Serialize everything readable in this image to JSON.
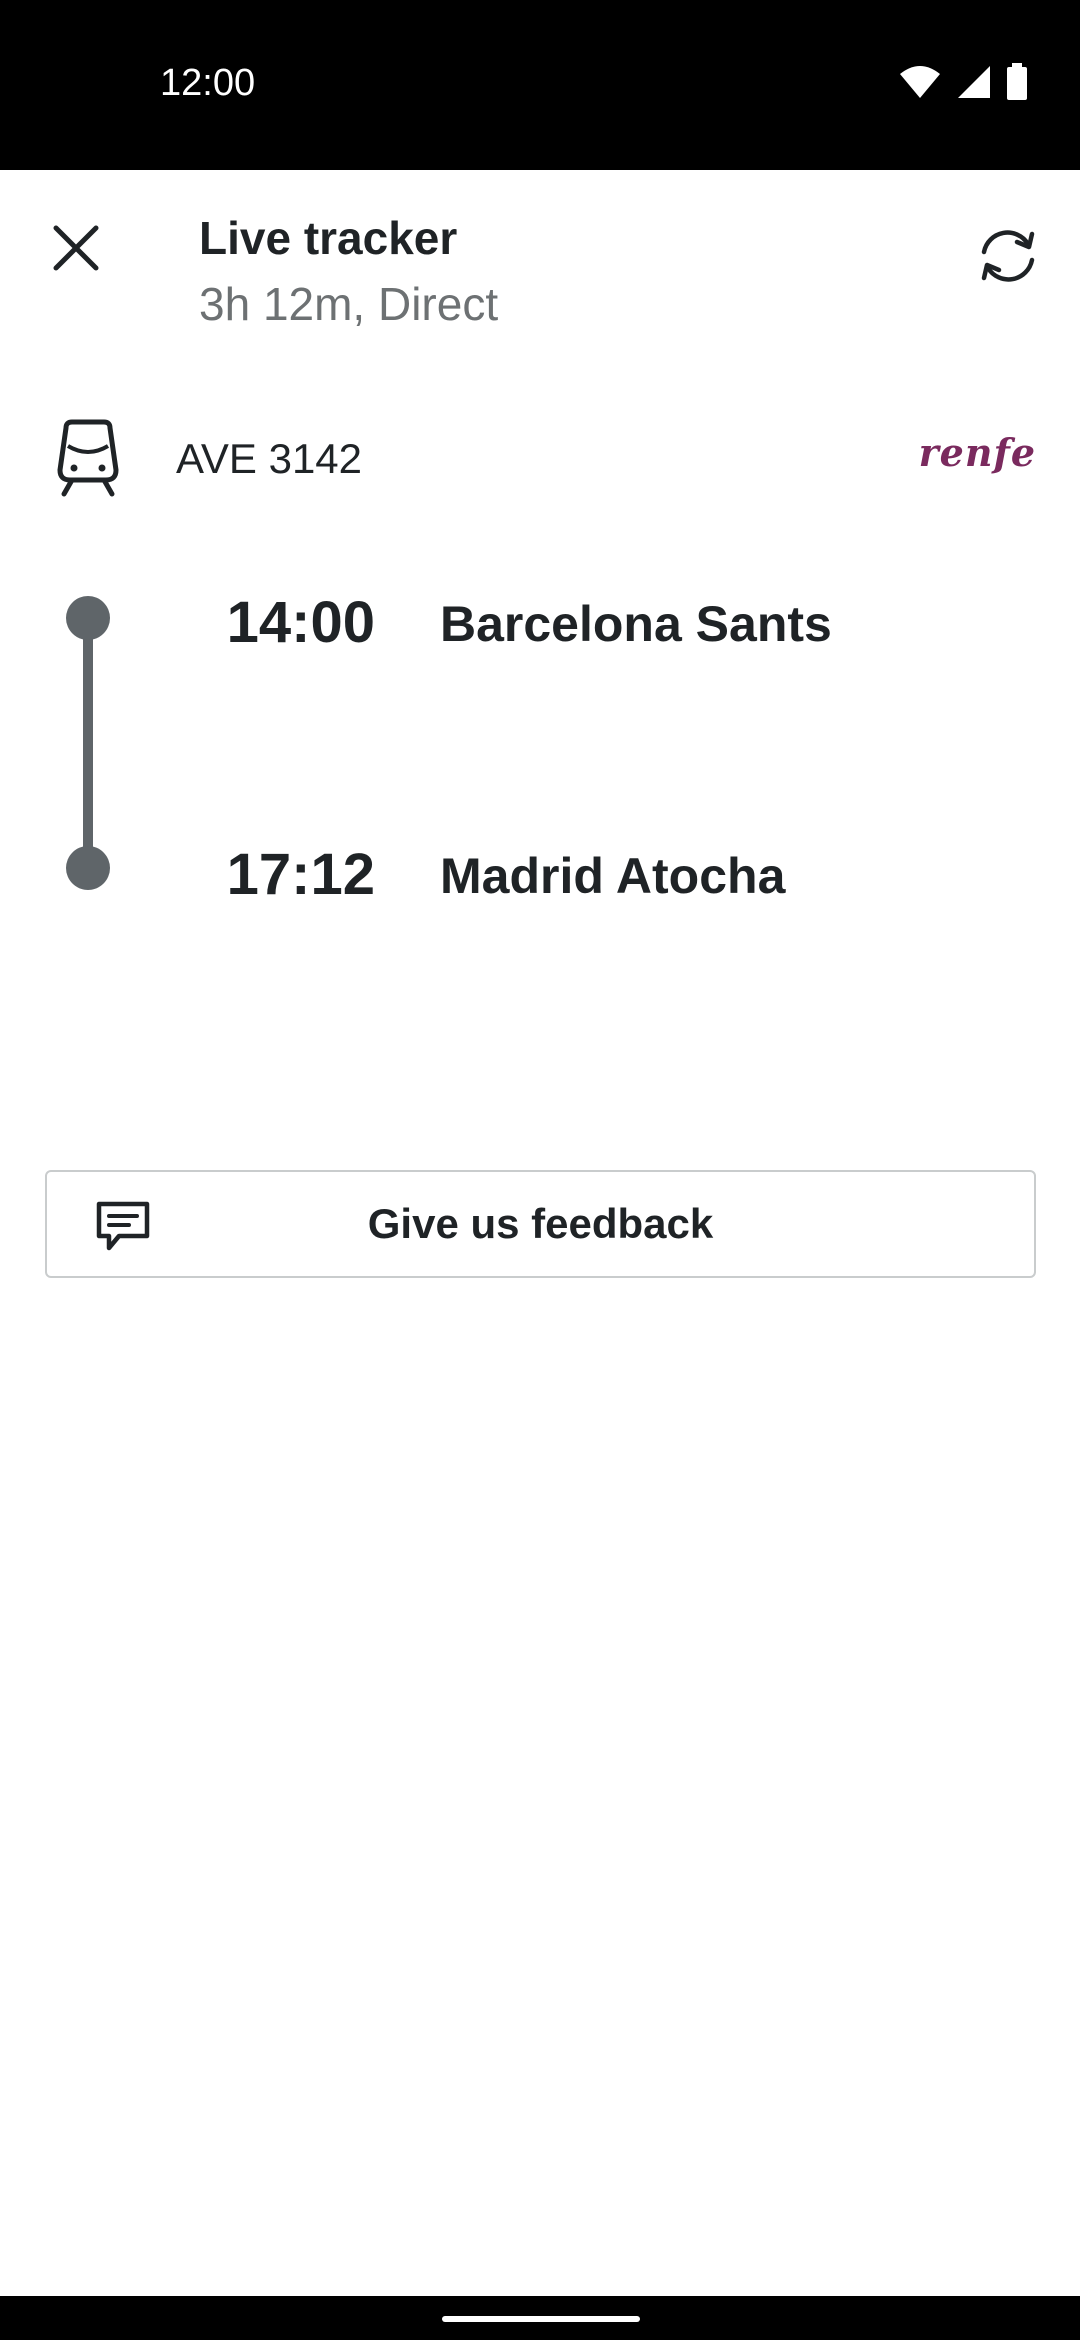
{
  "status_bar": {
    "time": "12:00",
    "icons": [
      "wifi-icon",
      "signal-icon",
      "battery-icon"
    ]
  },
  "header": {
    "title": "Live tracker",
    "subtitle": "3h 12m, Direct",
    "close_icon": "close-icon",
    "refresh_icon": "refresh-icon"
  },
  "train": {
    "icon": "train-icon",
    "number": "AVE 3142",
    "operator_logo_text": "renfe"
  },
  "journey": {
    "stops": [
      {
        "time": "14:00",
        "station": "Barcelona Sants"
      },
      {
        "time": "17:12",
        "station": "Madrid Atocha"
      }
    ]
  },
  "feedback": {
    "label": "Give us feedback",
    "icon": "chat-icon"
  },
  "colors": {
    "text_primary": "#1f2326",
    "text_secondary": "#6d7173",
    "timeline": "#5f6569",
    "operator_brand": "#7a2a5e",
    "button_border": "#c9cccd"
  }
}
